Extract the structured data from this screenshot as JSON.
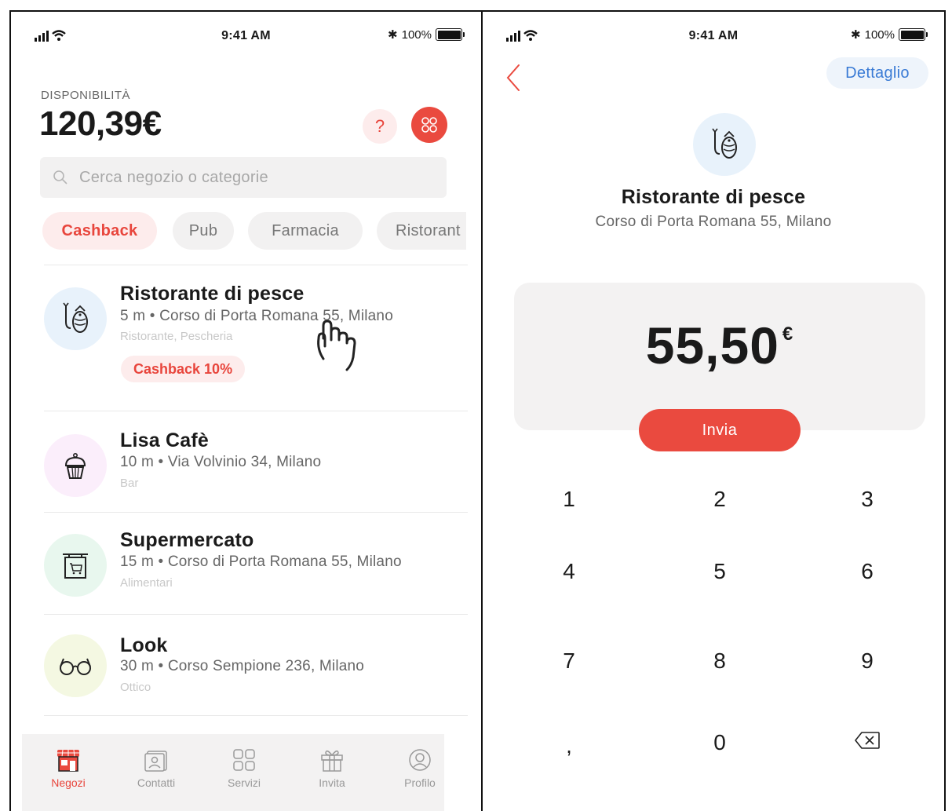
{
  "status": {
    "time": "9:41 AM",
    "battery": "100%"
  },
  "home": {
    "availability_label": "DISPONIBILITÀ",
    "balance": "120,39€",
    "help_label": "?",
    "search_placeholder": "Cerca negozio o categorie",
    "chips": [
      "Cashback",
      "Pub",
      "Farmacia",
      "Ristorant"
    ],
    "stores": [
      {
        "name": "Ristorante di pesce",
        "address": "5 m • Corso di Porta Romana 55, Milano",
        "category": "Ristorante, Pescheria",
        "badge": "Cashback 10%",
        "icon": "fish-icon",
        "color": "#e8f2fb"
      },
      {
        "name": "Lisa Cafè",
        "address": "10 m • Via Volvinio 34, Milano",
        "category": "Bar",
        "icon": "cupcake-icon",
        "color": "#fbeefb"
      },
      {
        "name": "Supermercato",
        "address": "15 m • Corso di Porta Romana 55, Milano",
        "category": "Alimentari",
        "icon": "shop-sign-icon",
        "color": "#e8f7ee"
      },
      {
        "name": "Look",
        "address": "30 m • Corso Sempione 236, Milano",
        "category": "Ottico",
        "icon": "glasses-icon",
        "color": "#f4f8e2"
      }
    ],
    "tabs": [
      "Negozi",
      "Contatti",
      "Servizi",
      "Invita",
      "Profilo"
    ],
    "accent": "#ea4a3f"
  },
  "payment": {
    "detail_label": "Dettaglio",
    "store_name": "Ristorante di pesce",
    "store_address": "Corso di Porta Romana 55, Milano",
    "amount": "55,50",
    "currency": "€",
    "send_label": "Invia",
    "keys": [
      "1",
      "2",
      "3",
      "4",
      "5",
      "6",
      "7",
      "8",
      "9",
      ",",
      "0"
    ]
  }
}
